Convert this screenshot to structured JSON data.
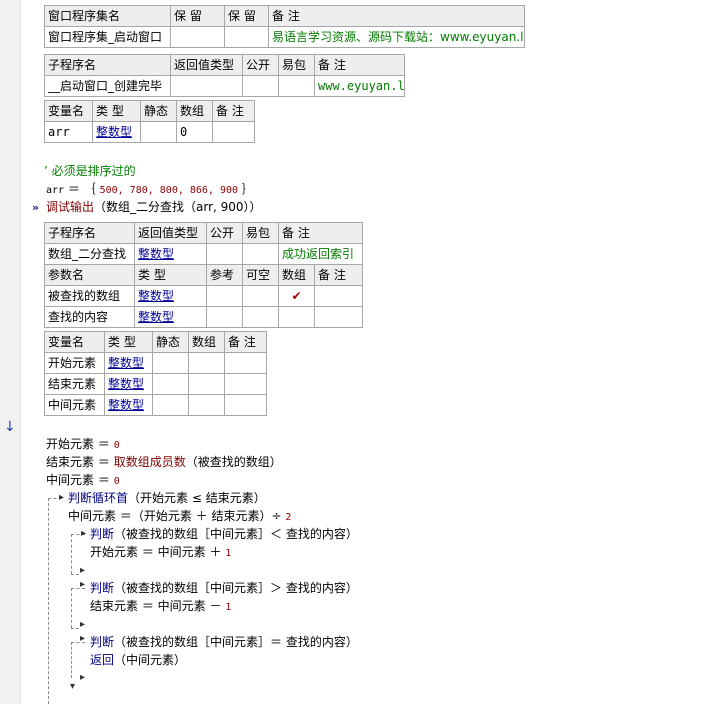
{
  "program_set_table": {
    "headers": [
      "窗口程序集名",
      "保 留",
      "保 留",
      "备 注"
    ],
    "row": [
      "窗口程序集_启动窗口",
      "",
      "",
      "易语言学习资源、源码下载站：www.eyuyan.la"
    ]
  },
  "sub_table_1": {
    "headers": [
      "子程序名",
      "返回值类型",
      "公开",
      "易包",
      "备 注"
    ],
    "row": [
      "__启动窗口_创建完毕",
      "",
      "",
      "",
      "www.eyuyan.la"
    ]
  },
  "var_table_1": {
    "headers": [
      "变量名",
      "类 型",
      "静态",
      "数组",
      "备 注"
    ],
    "row": [
      "arr",
      "整数型",
      "",
      "0",
      ""
    ]
  },
  "code_1": {
    "comment": "’ 必须是排序过的",
    "assign_var": "arr",
    "assign_op": "＝",
    "array_open": "｛",
    "array_values": "500,  780,  800,  866,  900",
    "array_close": "｝",
    "debug_call": "调试输出",
    "debug_args": "（数组_二分查找（arr, 900））"
  },
  "sub_table_2": {
    "headers": [
      "子程序名",
      "返回值类型",
      "公开",
      "易包",
      "备 注"
    ],
    "row": [
      "数组_二分查找",
      "整数型",
      "",
      "",
      "成功返回索引"
    ],
    "param_headers": [
      "参数名",
      "类 型",
      "参考",
      "可空",
      "数组",
      "备 注"
    ],
    "params": [
      [
        "被查找的数组",
        "整数型",
        "",
        "",
        "✔",
        ""
      ],
      [
        "查找的内容",
        "整数型",
        "",
        "",
        "",
        ""
      ]
    ]
  },
  "var_table_2": {
    "headers": [
      "变量名",
      "类 型",
      "静态",
      "数组",
      "备 注"
    ],
    "rows": [
      [
        "开始元素",
        "整数型",
        "",
        "",
        ""
      ],
      [
        "结束元素",
        "整数型",
        "",
        "",
        ""
      ],
      [
        "中间元素",
        "整数型",
        "",
        "",
        ""
      ]
    ]
  },
  "code_2": {
    "l1_var": "开始元素",
    "l1_rest": "＝",
    "l1_val": "0",
    "l2_var": "结束元素",
    "l2_op": "＝",
    "l2_fn": "取数组成员数",
    "l2_args": "（被查找的数组）",
    "l3_var": "中间元素",
    "l3_op": "＝",
    "l3_val": "0",
    "loop_kw": "判断循环首",
    "loop_args": "（开始元素 ≤ 结束元素）",
    "mid_expr": "中间元素 ＝（开始元素 ＋ 结束元素）÷",
    "mid_num": "2",
    "if1_kw": "判断",
    "if1_args": "（被查找的数组［中间元素］＜ 查找的内容）",
    "if1_body": "开始元素 ＝ 中间元素 ＋",
    "if1_num": "1",
    "if2_kw": "判断",
    "if2_args": "（被查找的数组［中间元素］＞ 查找的内容）",
    "if2_body": "结束元素 ＝ 中间元素 －",
    "if2_num": "1",
    "if3_kw": "判断",
    "if3_args": "（被查找的数组［中间元素］＝ 查找的内容）",
    "ret_kw": "返回",
    "ret_args": "（中间元素）"
  },
  "icons": {
    "breakpoint": "»",
    "down_arrow": "↓"
  }
}
